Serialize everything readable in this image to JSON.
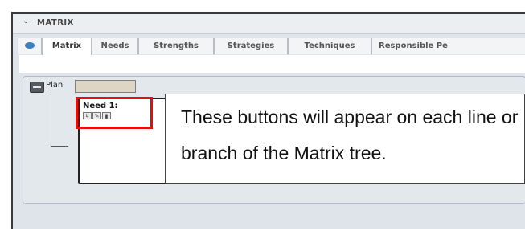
{
  "panel": {
    "title": "MATRIX"
  },
  "tabs": [
    {
      "label": ""
    },
    {
      "label": "Matrix"
    },
    {
      "label": "Needs"
    },
    {
      "label": "Strengths"
    },
    {
      "label": "Strategies"
    },
    {
      "label": "Techniques"
    },
    {
      "label": "Responsible Pe"
    }
  ],
  "tree": {
    "plan_label": "Plan",
    "plan_value": "",
    "need_label": "Need 1:",
    "need_buttons": [
      "link-icon",
      "edit-icon",
      "delete-icon"
    ]
  },
  "callout": {
    "text": "These buttons will appear on each line or branch of the Matrix tree."
  }
}
